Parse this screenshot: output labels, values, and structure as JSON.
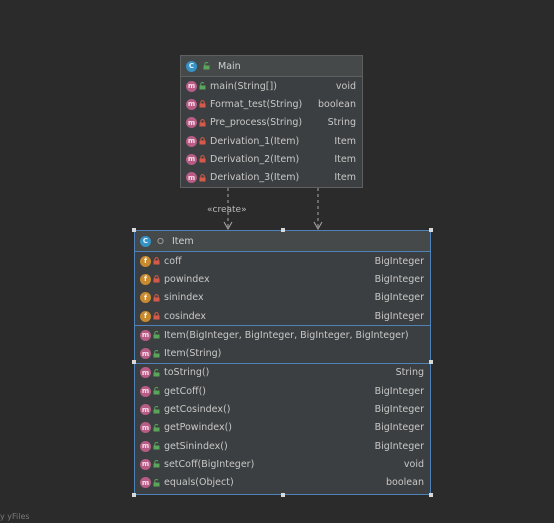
{
  "main_node": {
    "title": "Main",
    "methods": [
      {
        "name": "main(String[])",
        "type": "void",
        "visibility": "public"
      },
      {
        "name": "Format_test(String)",
        "type": "boolean",
        "visibility": "private"
      },
      {
        "name": "Pre_process(String)",
        "type": "String",
        "visibility": "private"
      },
      {
        "name": "Derivation_1(Item)",
        "type": "Item",
        "visibility": "private"
      },
      {
        "name": "Derivation_2(Item)",
        "type": "Item",
        "visibility": "private"
      },
      {
        "name": "Derivation_3(Item)",
        "type": "Item",
        "visibility": "private"
      }
    ]
  },
  "item_node": {
    "title": "Item",
    "fields": [
      {
        "name": "coff",
        "type": "BigInteger",
        "visibility": "private"
      },
      {
        "name": "powindex",
        "type": "BigInteger",
        "visibility": "private"
      },
      {
        "name": "sinindex",
        "type": "BigInteger",
        "visibility": "private"
      },
      {
        "name": "cosindex",
        "type": "BigInteger",
        "visibility": "private"
      }
    ],
    "constructors": [
      {
        "name": "Item(BigInteger, BigInteger, BigInteger, BigInteger)",
        "type": "",
        "visibility": "public"
      },
      {
        "name": "Item(String)",
        "type": "",
        "visibility": "public"
      }
    ],
    "methods": [
      {
        "name": "toString()",
        "type": "String",
        "visibility": "public"
      },
      {
        "name": "getCoff()",
        "type": "BigInteger",
        "visibility": "public"
      },
      {
        "name": "getCosindex()",
        "type": "BigInteger",
        "visibility": "public"
      },
      {
        "name": "getPowindex()",
        "type": "BigInteger",
        "visibility": "public"
      },
      {
        "name": "getSinindex()",
        "type": "BigInteger",
        "visibility": "public"
      },
      {
        "name": "setCoff(BigInteger)",
        "type": "void",
        "visibility": "public"
      },
      {
        "name": "equals(Object)",
        "type": "boolean",
        "visibility": "public"
      }
    ]
  },
  "edges": {
    "create_label": "«create»"
  },
  "watermark": "y yFiles",
  "colors": {
    "background": "#2b2b2b",
    "node_fill": "#3c3f41",
    "selection": "#4f82b8",
    "class_badge": "#3592c4",
    "method_badge": "#b85c86",
    "field_badge": "#c98a2f",
    "private_lock": "#d65a4a",
    "public_green": "#5aa55a"
  }
}
